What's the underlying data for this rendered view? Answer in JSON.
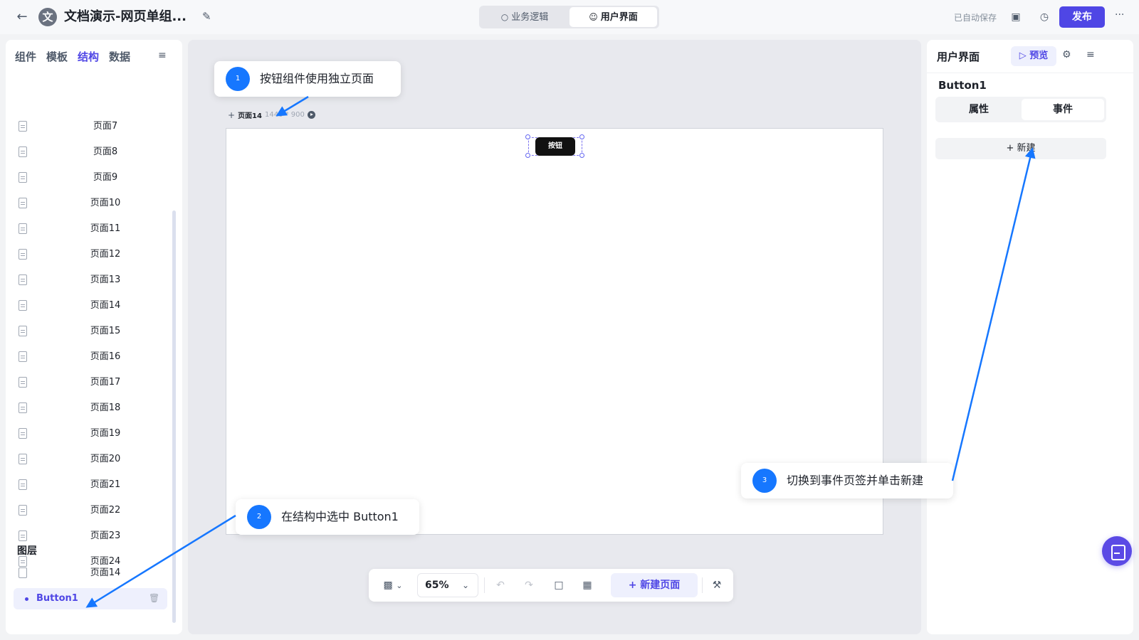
{
  "topbar": {
    "back_icon": "arrow-left-icon",
    "avatar_text": "文",
    "app_title": "文档演示-网页单组...",
    "mode_tabs": [
      {
        "label": "业务逻辑",
        "icon": "share-icon"
      },
      {
        "label": "用户界面",
        "icon": "user-icon",
        "active": true
      }
    ],
    "autosave_text": "已自动保存",
    "publish_label": "发布",
    "more_label": "···"
  },
  "left_panel": {
    "tabs": [
      {
        "label": "组件"
      },
      {
        "label": "模板"
      },
      {
        "label": "结构",
        "active": true
      },
      {
        "label": "数据"
      }
    ],
    "pages": [
      "页面7",
      "页面8",
      "页面9",
      "页面10",
      "页面11",
      "页面12",
      "页面13",
      "页面14",
      "页面15",
      "页面16",
      "页面17",
      "页面18",
      "页面19",
      "页面20",
      "页面21",
      "页面22",
      "页面23",
      "页面24"
    ],
    "layers_title": "图层",
    "layer_page": "页面14",
    "layer_button": "Button1"
  },
  "canvas": {
    "page_name": "页面14",
    "page_size": "1440 * 900",
    "button_label": "按钮",
    "zoom": "65%",
    "new_page_label": "新建页面"
  },
  "right_panel": {
    "title": "用户界面",
    "preview_label": "预览",
    "component_name": "Button1",
    "tabs": [
      {
        "label": "属性"
      },
      {
        "label": "事件",
        "active": true
      }
    ],
    "new_event_label": "新建"
  },
  "callouts": [
    {
      "number": "1",
      "text": "按钮组件使用独立页面"
    },
    {
      "number": "2",
      "text": "在结构中选中 Button1"
    },
    {
      "number": "3",
      "text": "切换到事件页签并单击新建"
    }
  ],
  "colors": {
    "accent": "#4f46e5",
    "callout_blue": "#1677ff",
    "arrow_blue": "#1677ff"
  }
}
